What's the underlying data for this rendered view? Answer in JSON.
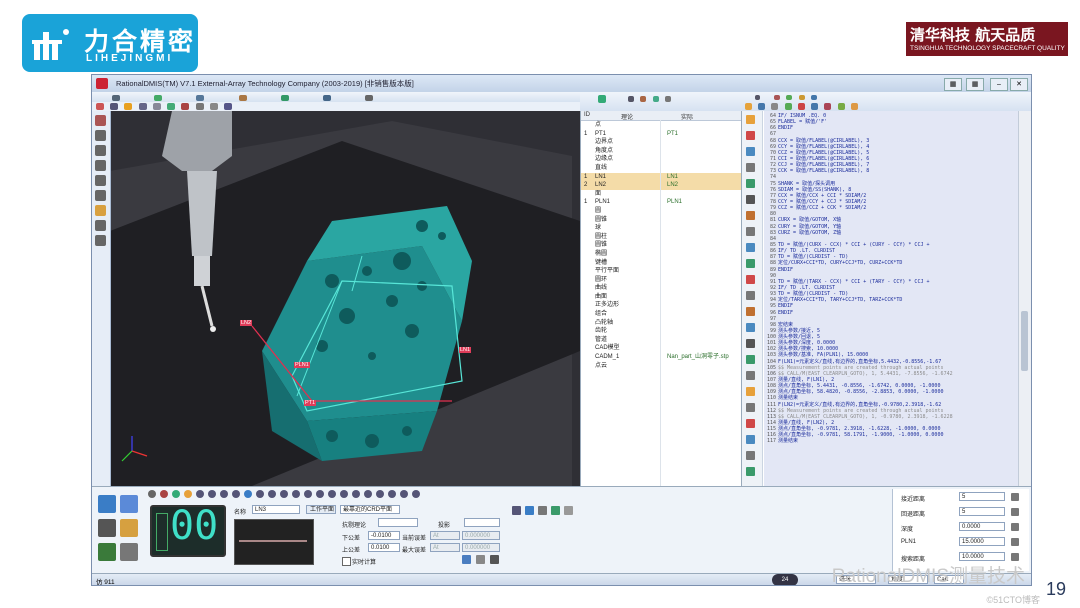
{
  "slide": {
    "logo_cn": "力合精密",
    "logo_en": "LIHEJINGMI",
    "tsinghua_cn": "清华科技 航天品质",
    "tsinghua_en": "TSINGHUA TECHNOLOGY SPACECRAFT QUALITY",
    "watermark": "RationalDMIS测量技术",
    "page_number": "19",
    "csdn": "©51CTO博客"
  },
  "window": {
    "title": "RationalDMIS(TM) V7.1  External-Array Technology Company (2003-2019) [非销售版本版]"
  },
  "tree": {
    "headers": [
      "ID",
      "理论",
      "实际"
    ],
    "rows": [
      {
        "n": "",
        "name": "点",
        "act": ""
      },
      {
        "n": "1",
        "name": "PT1",
        "act": "PT1"
      },
      {
        "n": "",
        "name": "边界点",
        "act": ""
      },
      {
        "n": "",
        "name": "角度点",
        "act": ""
      },
      {
        "n": "",
        "name": "边缘点",
        "act": ""
      },
      {
        "n": "",
        "name": "直线",
        "act": ""
      },
      {
        "n": "1",
        "name": "LN1",
        "act": "LN1",
        "sel": true
      },
      {
        "n": "2",
        "name": "LN2",
        "act": "LN2",
        "sel": true
      },
      {
        "n": "",
        "name": "面",
        "act": ""
      },
      {
        "n": "1",
        "name": "PLN1",
        "act": "PLN1"
      },
      {
        "n": "",
        "name": "圆",
        "act": ""
      },
      {
        "n": "",
        "name": "圆锥",
        "act": ""
      },
      {
        "n": "",
        "name": "球",
        "act": ""
      },
      {
        "n": "",
        "name": "圆柱",
        "act": ""
      },
      {
        "n": "",
        "name": "圆锥",
        "act": ""
      },
      {
        "n": "",
        "name": "椭圆",
        "act": ""
      },
      {
        "n": "",
        "name": "键槽",
        "act": ""
      },
      {
        "n": "",
        "name": "平行平面",
        "act": ""
      },
      {
        "n": "",
        "name": "圆环",
        "act": ""
      },
      {
        "n": "",
        "name": "曲线",
        "act": ""
      },
      {
        "n": "",
        "name": "曲面",
        "act": ""
      },
      {
        "n": "",
        "name": "正多边形",
        "act": ""
      },
      {
        "n": "",
        "name": "组合",
        "act": ""
      },
      {
        "n": "",
        "name": "凸轮轴",
        "act": ""
      },
      {
        "n": "",
        "name": "齿轮",
        "act": ""
      },
      {
        "n": "",
        "name": "管道",
        "act": ""
      },
      {
        "n": "",
        "name": "CAD模型",
        "act": ""
      },
      {
        "n": "",
        "name": "CADM_1",
        "act": "Nan_part_山洞零子.stp"
      },
      {
        "n": "",
        "name": "点云",
        "act": ""
      }
    ]
  },
  "code": {
    "lines": [
      {
        "ln": "64",
        "t": "    IF/ ISNUM .EQ. 0",
        "g": false
      },
      {
        "ln": "65",
        "t": "        FLABEL = 赋值/'F'",
        "g": false
      },
      {
        "ln": "66",
        "t": "    ENDIF",
        "g": false
      },
      {
        "ln": "67",
        "t": "",
        "g": false
      },
      {
        "ln": "68",
        "t": "    CCX = 取值/FLABEL(@CIRLABEL), 3",
        "g": false
      },
      {
        "ln": "69",
        "t": "    CCY = 取值/FLABEL(@CIRLABEL), 4",
        "g": false
      },
      {
        "ln": "70",
        "t": "    CCZ = 取值/FLABEL(@CIRLABEL), 5",
        "g": false
      },
      {
        "ln": "71",
        "t": "    CCI = 取值/FLABEL(@CIRLABEL), 6",
        "g": false
      },
      {
        "ln": "72",
        "t": "    CCJ = 取值/FLABEL(@CIRLABEL), 7",
        "g": false
      },
      {
        "ln": "73",
        "t": "    CCK = 取值/FLABEL(@CIRLABEL), 8",
        "g": false
      },
      {
        "ln": "74",
        "t": "",
        "g": false
      },
      {
        "ln": "75",
        "t": "    SHANK = 取值/探头调用",
        "g": false
      },
      {
        "ln": "76",
        "t": "    SDIAM = 取值/SS(SHANK), 8",
        "g": false
      },
      {
        "ln": "77",
        "t": "    CCX = 赋值/CCX + CCI * SDIAM/2",
        "g": false
      },
      {
        "ln": "78",
        "t": "    CCY = 赋值/CCY + CCJ * SDIAM/2",
        "g": false
      },
      {
        "ln": "79",
        "t": "    CCZ = 赋值/CCZ + CCK * SDIAM/2",
        "g": false
      },
      {
        "ln": "80",
        "t": "",
        "g": false
      },
      {
        "ln": "81",
        "t": "    CURX = 取值/GOTOM, X轴",
        "g": false
      },
      {
        "ln": "82",
        "t": "    CURY = 取值/GOTOM, Y轴",
        "g": false
      },
      {
        "ln": "83",
        "t": "    CURZ = 取值/GOTOM, Z轴",
        "g": false
      },
      {
        "ln": "84",
        "t": "",
        "g": false
      },
      {
        "ln": "85",
        "t": "    TD = 赋值/(CURX - CCX) * CCI + (CURY - CCY) * CCJ +",
        "g": false
      },
      {
        "ln": "86",
        "t": "    IF/ TD .LT. CLRDIST",
        "g": false
      },
      {
        "ln": "87",
        "t": "        TD = 赋值/(CLRDIST - TD)",
        "g": false
      },
      {
        "ln": "88",
        "t": "        定位/CURX+CCI*TD, CURY+CCJ*TD, CURZ+CCK*TD",
        "g": false
      },
      {
        "ln": "89",
        "t": "    ENDIF",
        "g": false
      },
      {
        "ln": "90",
        "t": "",
        "g": false
      },
      {
        "ln": "91",
        "t": "    TD = 赋值/(TARX - CCX) * CCI + (TARY - CCY) * CCJ +",
        "g": false
      },
      {
        "ln": "92",
        "t": "    IF/ TD .LT. CLRDIST",
        "g": false
      },
      {
        "ln": "93",
        "t": "        TD = 赋值/(CLRDIST - TD)",
        "g": false
      },
      {
        "ln": "94",
        "t": "        定位/TARX+CCI*TD, TARY+CCJ*TD, TARZ+CCK*TD",
        "g": false
      },
      {
        "ln": "95",
        "t": "    ENDIF",
        "g": false
      },
      {
        "ln": "96",
        "t": "ENDIF",
        "g": false
      },
      {
        "ln": "97",
        "t": "",
        "g": false
      },
      {
        "ln": "98",
        "t": "宏结束",
        "g": false
      },
      {
        "ln": "99",
        "t": "测头参数/接近, 5",
        "g": false
      },
      {
        "ln": "100",
        "t": "测头参数/回退, 5",
        "g": false
      },
      {
        "ln": "101",
        "t": "测头参数/深度, 0.0000",
        "g": false
      },
      {
        "ln": "102",
        "t": "测头参数/搜索, 10.0000",
        "g": false
      },
      {
        "ln": "103",
        "t": "测头参数/基准, FA(PLN1), 15.0000",
        "g": false
      },
      {
        "ln": "104",
        "t": "F(LN1)=元素定义/直线,有边界的,直角坐标,5.4432,-0.8556,-1.67",
        "g": false
      },
      {
        "ln": "105",
        "t": "$$ Measurement points are created through actual points",
        "g": true
      },
      {
        "ln": "106",
        "t": "$$ CALL/M(EAST_CLEARPLN_GOTO), 1, 5.4431, -7.8556, -1.6742",
        "g": true
      },
      {
        "ln": "107",
        "t": "测量/直线, F(LN1), 2",
        "g": false
      },
      {
        "ln": "108",
        "t": "  测点/直角坐标, 5.4431, -0.8556, -1.6742, 0.0000, -1.0000",
        "g": false
      },
      {
        "ln": "109",
        "t": "  测点/直角坐标, 58.4820, -0.8556, -2.8853, 0.0000, -1.0000",
        "g": false
      },
      {
        "ln": "110",
        "t": "测量结束",
        "g": false
      },
      {
        "ln": "111",
        "t": "F(LN2)=元素定义/直线,有边界的,直角坐标,-0.9780,2.3918,-1.62",
        "g": false
      },
      {
        "ln": "112",
        "t": "$$ Measurement points are created through actual points",
        "g": true
      },
      {
        "ln": "113",
        "t": "$$ CALL/M(EAST_CLEARPLN_GOTO), 1, -0.9780, 2.3918, -1.6228",
        "g": true
      },
      {
        "ln": "114",
        "t": "测量/直线, F(LN2), 2",
        "g": false
      },
      {
        "ln": "115",
        "t": "  测点/直角坐标, -0.9781, 2.3918, -1.6228, -1.0000, 0.0000",
        "g": false
      },
      {
        "ln": "116",
        "t": "  测点/直角坐标, -0.9781, 58.1791, -1.9000, -1.0000, 0.0000",
        "g": false
      },
      {
        "ln": "117",
        "t": "测量结束",
        "g": false
      }
    ]
  },
  "labels3d": {
    "ln2": "LN2",
    "ln1": "LN1",
    "pln1": "PLN1",
    "pt1": "PT1"
  },
  "bottom": {
    "counter": "00",
    "name_label": "名称",
    "name_value": "LN3",
    "workplane_btn": "工作平面",
    "plane_select": "最靠近的CRD平面",
    "collision_label": "抗剔理论",
    "projection_label": "投影",
    "lower_tol_label": "下公差",
    "lower_tol_value": "-0.0100",
    "upper_tol_label": "上公差",
    "upper_tol_value": "0.0100",
    "cur_err_label": "当前误差",
    "max_err_label": "最大误差",
    "at_label": "At",
    "at1_value": "0.000000",
    "at2_value": "0.000000",
    "realtime_label": "实时计算",
    "right_rows": [
      {
        "label": "接近距离",
        "value": "5"
      },
      {
        "label": "回退距离",
        "value": "5"
      },
      {
        "label": "深度",
        "value": "0.0000"
      },
      {
        "label": "PLN1",
        "value": "15.0000"
      },
      {
        "label": "搜索距离",
        "value": "10.0000"
      }
    ]
  },
  "status": {
    "left": "仿 911",
    "unit": "毫米",
    "angle": "角度",
    "cart": "Cart",
    "zoom": "24"
  }
}
